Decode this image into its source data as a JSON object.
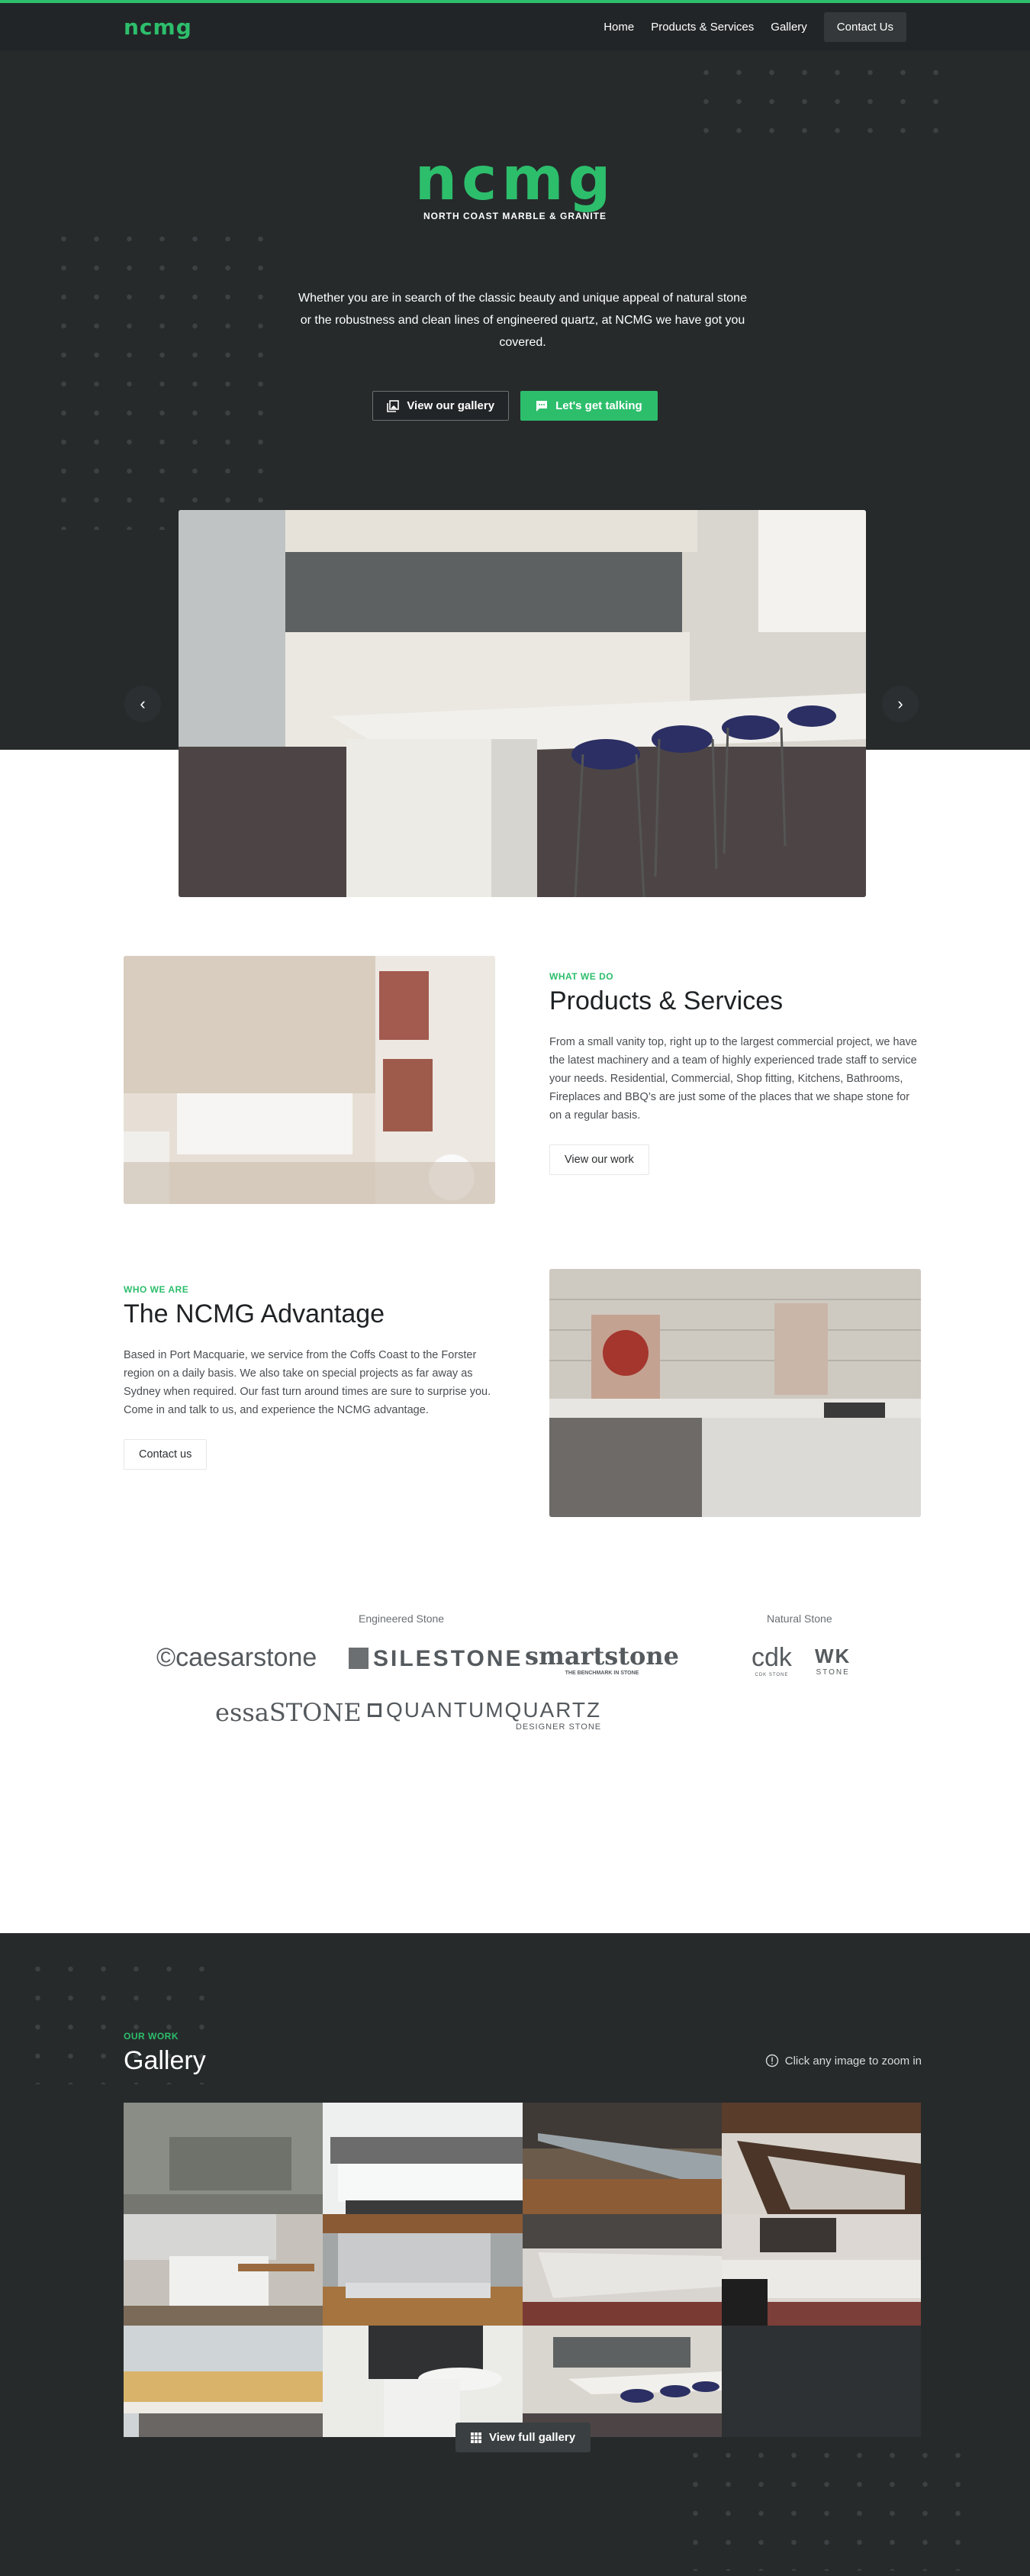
{
  "colors": {
    "accent": "#2dbe6c",
    "dark_bg": "#262a2b",
    "nav_bg": "#222527"
  },
  "nav": {
    "logo": "ncmg",
    "links": [
      "Home",
      "Products & Services",
      "Gallery"
    ],
    "contact": "Contact Us"
  },
  "hero": {
    "logo_mark": "ncmg",
    "logo_sub": "NORTH COAST MARBLE & GRANITE",
    "text": "Whether you are in search of the classic beauty and unique appeal of natural stone or the robustness and clean lines of engineered quartz, at NCMG we have got you covered.",
    "btn_gallery": "View our gallery",
    "btn_gallery_icon": "photo-library-icon",
    "btn_talk": "Let's get talking",
    "btn_talk_icon": "chat-bubble-icon",
    "carousel_prev": "‹",
    "carousel_next": "›"
  },
  "products": {
    "eyebrow": "WHAT WE DO",
    "title": "Products & Services",
    "body": "From a small vanity top, right up to the largest commercial project, we have the latest machinery and a team of highly experienced trade staff to service your needs. Residential, Commercial, Shop fitting, Kitchens, Bathrooms, Fireplaces and BBQ’s are just some of the places that we shape stone for on a regular basis.",
    "button": "View our work"
  },
  "advantage": {
    "eyebrow": "WHO WE ARE",
    "title": "The NCMG Advantage",
    "body": "Based in Port Macquarie, we service from the Coffs Coast to the Forster region on a daily basis. We also take on special projects as far away as Sydney when required. Our fast turn around times are sure to surprise you. Come in and talk to us, and experience the NCMG advantage.",
    "button": "Contact us"
  },
  "brands": {
    "engineered_heading": "Engineered Stone",
    "natural_heading": "Natural Stone",
    "engineered": [
      {
        "name": "caesarstone",
        "tagline": ""
      },
      {
        "name": "SILESTONE",
        "tagline": ""
      },
      {
        "name": "smartstone",
        "tagline": "THE BENCHMARK IN STONE"
      },
      {
        "name": "essaSTONE",
        "tagline": ""
      },
      {
        "name": "QUANTUMQUARTZ",
        "tagline": "DESIGNER STONE"
      }
    ],
    "natural": [
      {
        "name": "cdk",
        "tagline": "CDK STONE"
      },
      {
        "name": "WK",
        "tagline": "STONE"
      }
    ]
  },
  "gallery": {
    "eyebrow": "OUR WORK",
    "title": "Gallery",
    "hint": "Click any image to zoom in",
    "hint_icon": "info-circle-icon",
    "button": "View full gallery",
    "button_icon": "grid-icon",
    "items": [
      "Stone sink basin",
      "Grey vanity with basin",
      "Bar counter with patterned front",
      "Bar with timber and patterned panels",
      "Kitchen island with timber table",
      "Marble splashback corner",
      "Commercial bar counter",
      "Bar counter with shelving",
      "Bottle display bar",
      "Kitchen with round island",
      "Kitchen with bar stools"
    ]
  }
}
